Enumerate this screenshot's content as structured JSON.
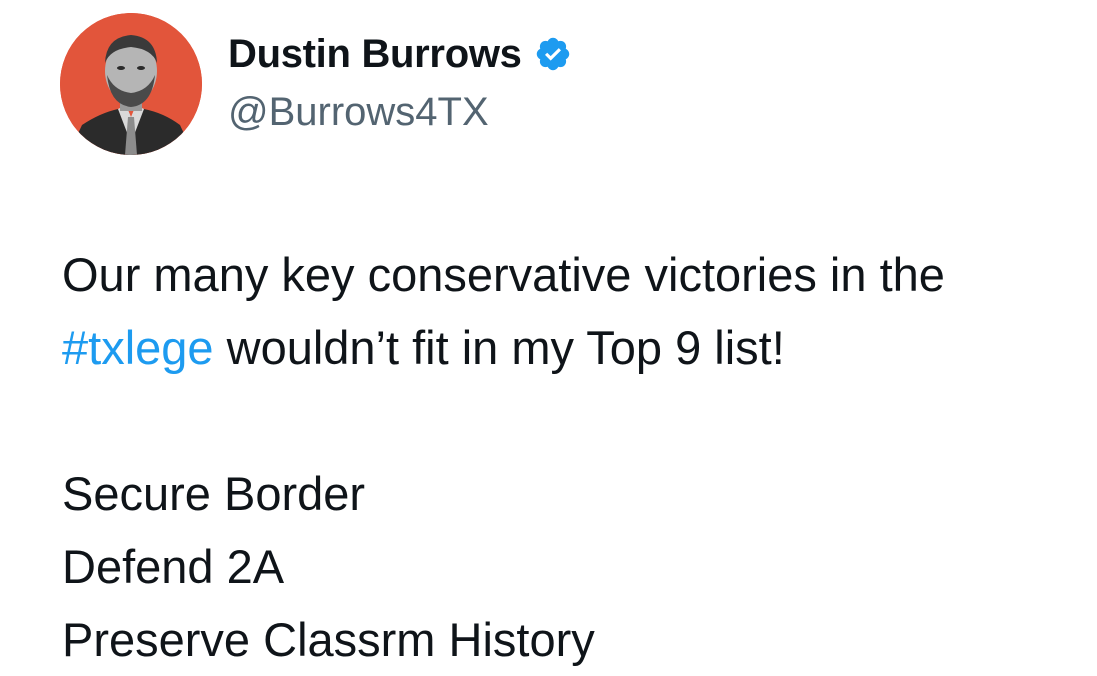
{
  "author": {
    "display_name": "Dustin Burrows",
    "handle": "@Burrows4TX",
    "verified": true,
    "verified_color": "#1d9bf0",
    "avatar_background": "#e2553b"
  },
  "tweet": {
    "line1": "Our many key conservative victories in the",
    "hashtag": "#txlege",
    "line2_rest": " wouldn’t fit in my Top 9 list!",
    "list_items": [
      "Secure Border",
      "Defend 2A",
      "Preserve Classrm History"
    ],
    "hashtag_color": "#1d9bf0"
  },
  "icons": {
    "verified": "verified-badge-icon",
    "avatar": "profile-photo"
  }
}
